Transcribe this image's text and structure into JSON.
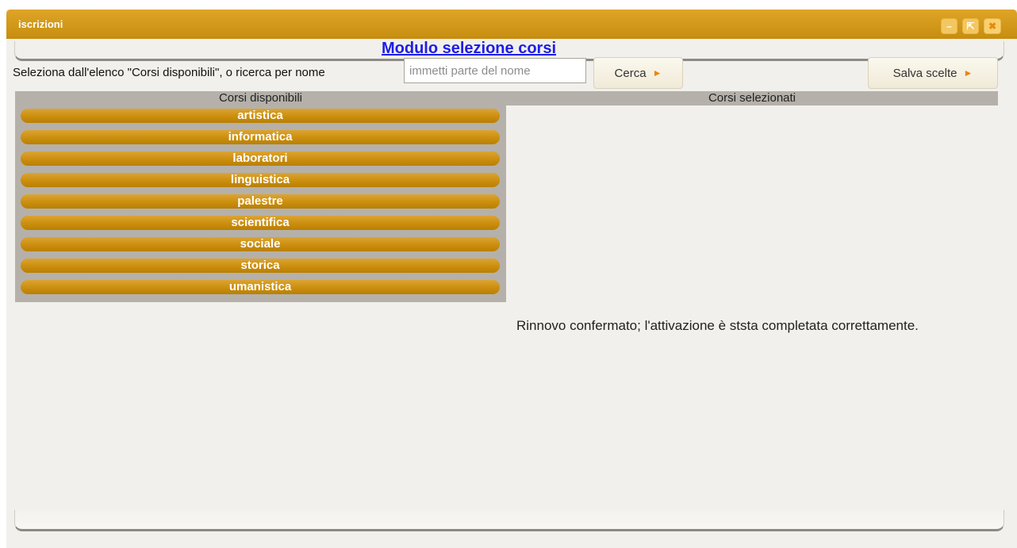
{
  "window": {
    "title": "iscrizioni",
    "buttons": {
      "minimize": "–",
      "external": "⇱",
      "close": "✖"
    }
  },
  "form": {
    "title": "Modulo selezione corsi",
    "instructions": "Seleziona dall'elenco \"Corsi disponibili\", o ricerca per nome",
    "search": {
      "placeholder": "immetti parte del nome",
      "value": ""
    },
    "search_button": "Cerca",
    "save_button": "Salva scelte",
    "button_arrow": "►"
  },
  "available": {
    "header": "Corsi disponibili",
    "courses": [
      "artistica",
      "informatica",
      "laboratori",
      "linguistica",
      "palestre",
      "scientifica",
      "sociale",
      "storica",
      "umanistica"
    ]
  },
  "selected": {
    "header": "Corsi selezionati"
  },
  "message": "Rinnovo confermato; l'attivazione è ststa completata correttamente.",
  "colors": {
    "titlebar": "#d39a1c",
    "course_item": "#cb8e0d",
    "form_title": "#1d1de8",
    "panel_bg": "#b5b1aa"
  }
}
